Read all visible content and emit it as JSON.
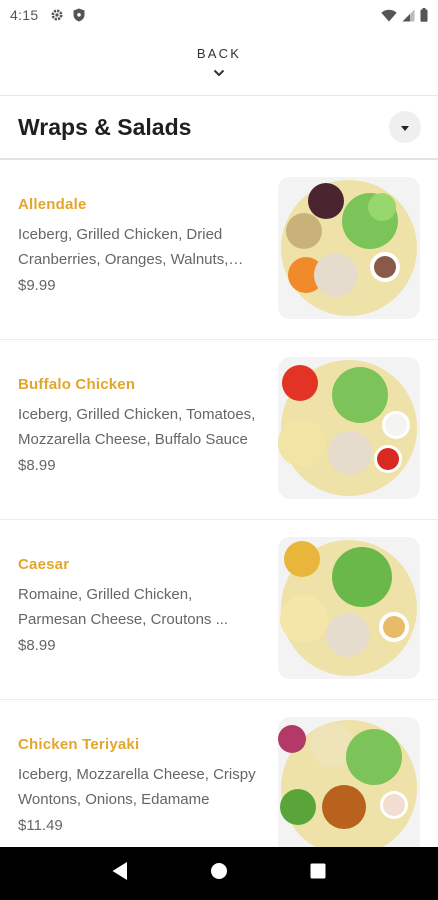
{
  "status": {
    "time": "4:15",
    "icons": [
      "gear-icon",
      "shield-icon",
      "wifi-icon",
      "signal-icon",
      "battery-icon"
    ]
  },
  "back": {
    "label": "BACK",
    "icon": "chevron-down-icon"
  },
  "category": {
    "title": "Wraps & Salads",
    "dropdown_icon": "caret-down-icon"
  },
  "colors": {
    "accent": "#e3a62c",
    "text_muted": "#666666"
  },
  "items": [
    {
      "name": "Allendale",
      "description": "Iceberg, Grilled Chicken, Dried Cranberries, Oranges, Walnuts, Feta Cheese",
      "price": "$9.99"
    },
    {
      "name": "Buffalo Chicken",
      "description": "Iceberg, Grilled Chicken, Tomatoes, Mozzarella Cheese, Buffalo Sauce",
      "price": "$8.99"
    },
    {
      "name": "Caesar",
      "description": "Romaine, Grilled Chicken, Parmesan Cheese, Croutons ...",
      "price": "$8.99"
    },
    {
      "name": "Chicken Teriyaki",
      "description": "Iceberg, Mozzarella Cheese, Crispy Wontons, Onions, Edamame",
      "price": "$11.49"
    }
  ],
  "nav": {
    "icons": [
      "back-triangle-icon",
      "home-circle-icon",
      "recents-square-icon"
    ]
  }
}
